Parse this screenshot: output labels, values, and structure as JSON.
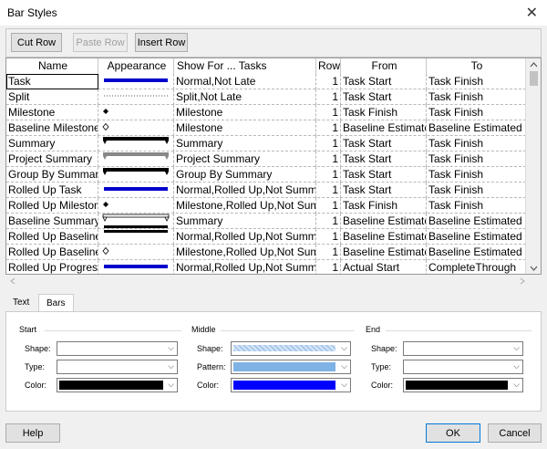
{
  "window": {
    "title": "Bar Styles",
    "close_glyph": "✕"
  },
  "toolbar": {
    "cut_row": "Cut Row",
    "paste_row": "Paste Row",
    "insert_row": "Insert Row"
  },
  "columns": [
    "Name",
    "Appearance",
    "Show For ... Tasks",
    "Row",
    "From",
    "To"
  ],
  "rows": [
    {
      "name": "Task",
      "show": "Normal,Not Late",
      "row": "1",
      "from": "Task Start",
      "to": "Task Finish",
      "appearance": "blue-bar"
    },
    {
      "name": "Split",
      "show": "Split,Not Late",
      "row": "1",
      "from": "Task Start",
      "to": "Task Finish",
      "appearance": "dotted-line"
    },
    {
      "name": "Milestone",
      "show": "Milestone",
      "row": "1",
      "from": "Task Finish",
      "to": "Task Finish",
      "appearance": "diamond-filled"
    },
    {
      "name": "Baseline Milestone",
      "show": "Milestone",
      "row": "1",
      "from": "Baseline Estimate",
      "to": "Baseline Estimated F",
      "appearance": "diamond-hollow"
    },
    {
      "name": "Summary",
      "show": "Summary",
      "row": "1",
      "from": "Task Start",
      "to": "Task Finish",
      "appearance": "summary-black"
    },
    {
      "name": "Project Summary",
      "show": "Project Summary",
      "row": "1",
      "from": "Task Start",
      "to": "Task Finish",
      "appearance": "summary-gray"
    },
    {
      "name": "Group By Summar",
      "show": "Group By Summary",
      "row": "1",
      "from": "Task Start",
      "to": "Task Finish",
      "appearance": "summary-black"
    },
    {
      "name": "Rolled Up Task",
      "show": "Normal,Rolled Up,Not Summ",
      "row": "1",
      "from": "Task Start",
      "to": "Task Finish",
      "appearance": "blue-bar"
    },
    {
      "name": "Rolled Up Mileston",
      "show": "Milestone,Rolled Up,Not Summ",
      "row": "1",
      "from": "Task Finish",
      "to": "Task Finish",
      "appearance": "diamond-filled"
    },
    {
      "name": "Baseline Summary",
      "show": "Summary",
      "row": "1",
      "from": "Baseline Estimate",
      "to": "Baseline Estimated F",
      "appearance": "summary-hollow"
    },
    {
      "name": "Rolled Up Baseline",
      "show": "Normal,Rolled Up,Not Summ",
      "row": "1",
      "from": "Baseline Estimate",
      "to": "Baseline Estimated F",
      "appearance": "black-thin-bar"
    },
    {
      "name": "Rolled Up Baseline",
      "show": "Milestone,Rolled Up,Not Summ",
      "row": "1",
      "from": "Baseline Estimate",
      "to": "Baseline Estimated F",
      "appearance": "diamond-hollow"
    },
    {
      "name": "Rolled Up Progress",
      "show": "Normal,Rolled Up,Not Summ",
      "row": "1",
      "from": "Actual Start",
      "to": "CompleteThrough",
      "appearance": "blue-bar"
    }
  ],
  "tabs": [
    "Text",
    "Bars"
  ],
  "panel": {
    "start": {
      "title": "Start",
      "shape": "Shape:",
      "type": "Type:",
      "color": "Color:",
      "color_value": "#000000"
    },
    "middle": {
      "title": "Middle",
      "shape": "Shape:",
      "pattern": "Pattern:",
      "color": "Color:",
      "color_value": "#0000ff",
      "shape_color": "#a9c8ec",
      "pattern_color": "#7fb2e5"
    },
    "end": {
      "title": "End",
      "shape": "Shape:",
      "type": "Type:",
      "color": "Color:",
      "color_value": "#000000"
    }
  },
  "footer": {
    "help": "Help",
    "ok": "OK",
    "cancel": "Cancel"
  }
}
